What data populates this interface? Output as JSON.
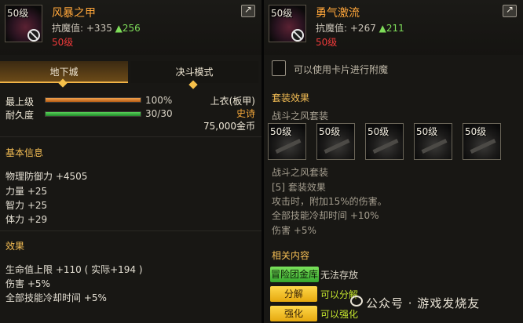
{
  "left": {
    "item": {
      "level": "50级",
      "name": "风暴之甲",
      "stat_label": "抗魔值:",
      "stat_value": "+335",
      "stat_bonus": "▲256",
      "required_level": "50级"
    },
    "tabs": [
      {
        "label": "地下城"
      },
      {
        "label": "决斗模式"
      }
    ],
    "highest_grade": {
      "label": "最上级",
      "value": "100%",
      "fill": 1.0
    },
    "durability": {
      "label": "耐久度",
      "value": "30/30",
      "fill": 1.0
    },
    "slot_type": "上衣(板甲)",
    "rarity": "史诗",
    "price": "75,000金币",
    "basic_info": {
      "title": "基本信息",
      "lines": [
        "物理防御力 +4505",
        "力量 +25",
        "智力 +25",
        "体力 +29"
      ]
    },
    "effects": {
      "title": "效果",
      "lines": [
        "生命值上限 +110 ( 实际+194 )",
        "伤害 +5%",
        "全部技能冷却时间 +5%"
      ]
    }
  },
  "right": {
    "item": {
      "level": "50级",
      "name": "勇气激流",
      "stat_label": "抗魔值:",
      "stat_value": "+267",
      "stat_bonus": "▲211",
      "required_level": "50级"
    },
    "enchant_label": "可以使用卡片进行附魔",
    "set_effect_title": "套装效果",
    "set_name": "战斗之风套装",
    "set_pieces": [
      "50级",
      "50级",
      "50级",
      "50级",
      "50级"
    ],
    "set_detail": {
      "name": "战斗之风套装",
      "lines": [
        "[5] 套装效果",
        "攻击时，附加15%的伤害。",
        "全部技能冷却时间 +10%",
        "伤害 +5%"
      ]
    },
    "related_title": "相关内容",
    "actions": [
      {
        "label": "冒险团金库",
        "note": "无法存放"
      },
      {
        "label": "分解",
        "note": "可以分解"
      },
      {
        "label": "强化",
        "note": "可以强化"
      }
    ]
  },
  "watermark": "公众号 · 游戏发烧友",
  "colors": {
    "item_name": "#ffa63a",
    "section_title": "#f6bf55",
    "required_level": "#ef3a3a",
    "bonus_green": "#7edc59",
    "rarity": "#f2a63a"
  }
}
